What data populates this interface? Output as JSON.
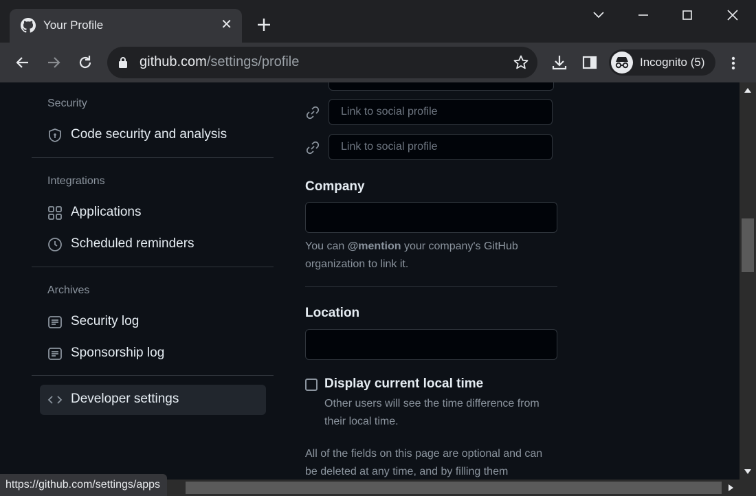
{
  "browser": {
    "tab_title": "Your Profile",
    "url_host": "github.com",
    "url_path": "/settings/profile",
    "profile_label": "Incognito (5)",
    "status_url": "https://github.com/settings/apps"
  },
  "sidebar": {
    "sections": [
      {
        "title": "Security",
        "items": [
          {
            "label": "Code security and analysis",
            "icon": "shield-lock-icon"
          }
        ]
      },
      {
        "title": "Integrations",
        "items": [
          {
            "label": "Applications",
            "icon": "apps-grid-icon"
          },
          {
            "label": "Scheduled reminders",
            "icon": "clock-icon"
          }
        ]
      },
      {
        "title": "Archives",
        "items": [
          {
            "label": "Security log",
            "icon": "log-icon"
          },
          {
            "label": "Sponsorship log",
            "icon": "log-icon"
          }
        ]
      }
    ],
    "developer_settings": {
      "label": "Developer settings",
      "icon": "code-icon"
    }
  },
  "form": {
    "social_placeholder": "Link to social profile",
    "company_label": "Company",
    "company_value": "",
    "company_help_pre": "You can ",
    "company_help_mention": "@mention",
    "company_help_post": " your company's GitHub organization to link it.",
    "location_label": "Location",
    "location_value": "",
    "local_time_label": "Display current local time",
    "local_time_checked": false,
    "local_time_help": "Other users will see the time difference from their local time.",
    "footer_note": "All of the fields on this page are optional and can be deleted at any time, and by filling them"
  },
  "colors": {
    "accent_bg": "#0d1117",
    "chrome": "#35363a",
    "border": "#30363d"
  }
}
